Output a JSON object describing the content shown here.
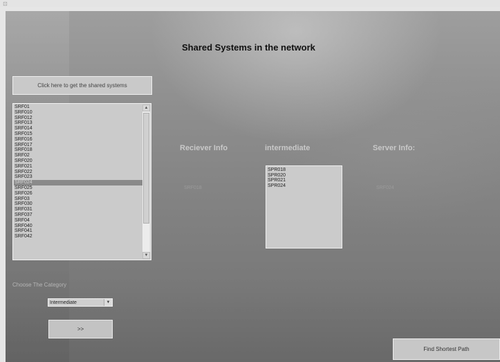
{
  "title": "Shared Systems in the network",
  "get_button_label": "Click here to get the shared systems",
  "shared_list": {
    "items": [
      "SRF01",
      "SRF010",
      "SRF012",
      "SRF013",
      "SRF014",
      "SRF015",
      "SRF016",
      "SRF017",
      "SRF018",
      "SRF02",
      "SRF020",
      "SRF021",
      "SRF022",
      "SRF023",
      "SRF024",
      "SRF025",
      "SRF026",
      "SRF03",
      "SRF030",
      "SRF031",
      "SRF037",
      "SRF04",
      "SRF040",
      "SRF041",
      "SRF042"
    ],
    "selected": "SRF024"
  },
  "headers": {
    "receiver": "Reciever Info",
    "intermediate": "intermediate",
    "server": "Server Info:"
  },
  "receiver_value": "SRF018",
  "server_value": "SRF024",
  "intermediate_list": [
    "SPR018",
    "SPR020",
    "SPR021",
    "SPR024"
  ],
  "category": {
    "label": "Choose The Category",
    "selected": "Intermediate"
  },
  "next_button_label": ">>",
  "find_path_label": "Find Shortest Path",
  "icons": {
    "scroll_up": "scroll-up-arrow-icon",
    "scroll_down": "scroll-down-arrow-icon",
    "dropdown": "chevron-down-icon"
  }
}
